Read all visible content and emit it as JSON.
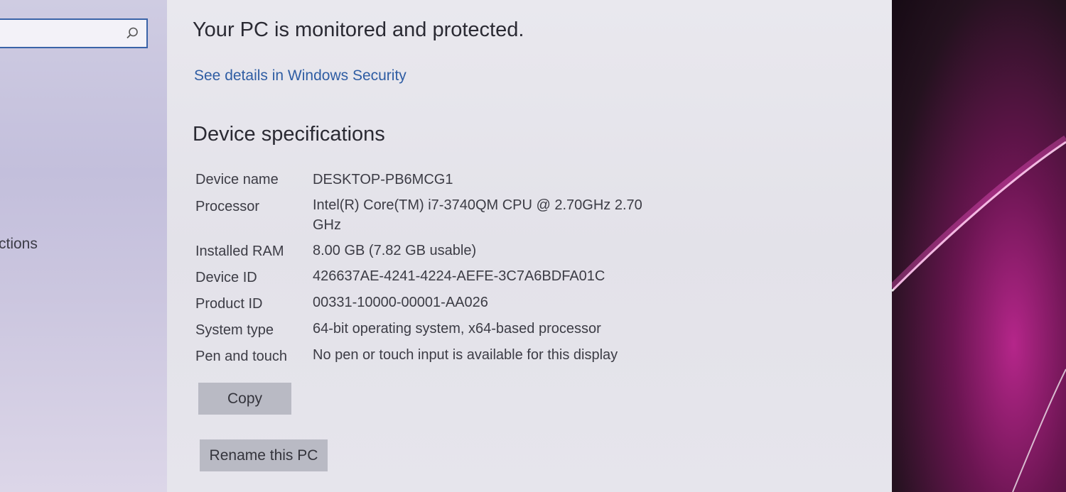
{
  "sidebar": {
    "search": {
      "placeholder": ""
    },
    "partial_item_label": "ctions"
  },
  "security": {
    "status_text": "Your PC is monitored and protected.",
    "details_link": "See details in Windows Security"
  },
  "device_specs": {
    "heading": "Device specifications",
    "rows": [
      {
        "label": "Device name",
        "value": "DESKTOP-PB6MCG1"
      },
      {
        "label": "Processor",
        "value": "Intel(R) Core(TM) i7-3740QM CPU @ 2.70GHz   2.70 GHz"
      },
      {
        "label": "Installed RAM",
        "value": "8.00 GB (7.82 GB usable)"
      },
      {
        "label": "Device ID",
        "value": "426637AE-4241-4224-AEFE-3C7A6BDFA01C"
      },
      {
        "label": "Product ID",
        "value": "00331-10000-00001-AA026"
      },
      {
        "label": "System type",
        "value": "64-bit operating system, x64-based processor"
      },
      {
        "label": "Pen and touch",
        "value": "No pen or touch input is available for this display"
      }
    ],
    "copy_label": "Copy",
    "rename_label": "Rename this PC"
  },
  "colors": {
    "link": "#2f5da3",
    "button_bg": "#b9bac4",
    "search_border": "#3a63a8"
  },
  "icons": {
    "search": "search-icon"
  }
}
